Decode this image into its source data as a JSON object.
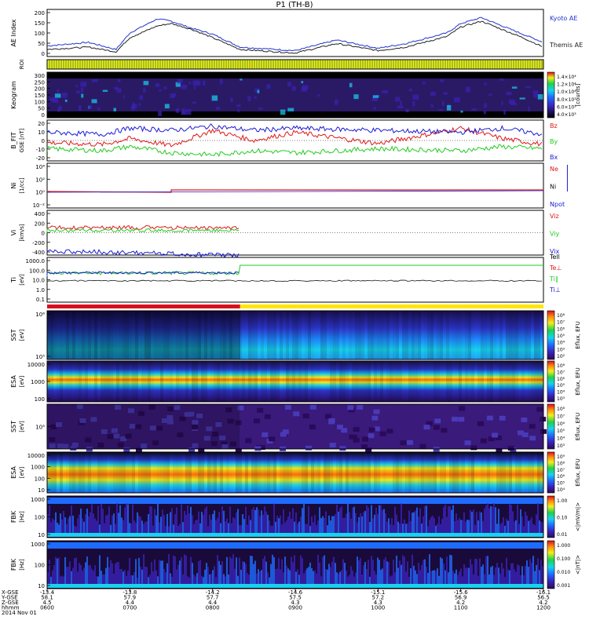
{
  "title": "P1  (TH-B)",
  "colors": {
    "kyoto": "#2233cc",
    "themis": "#222222",
    "bx": "#1b1bd6",
    "by": "#22cc22",
    "bz": "#e01818",
    "ni": "#111111",
    "ne": "#e01818",
    "npot": "#1b1bd6",
    "spec_bg": "#2a0a5a",
    "mode_slow": "#d8101c",
    "mode_fast": "#ffe600"
  },
  "chart_data": [
    {
      "type": "line",
      "panel": "ae",
      "ylabel": "AE Index",
      "yticks": [
        "200",
        "150",
        "100",
        "50",
        "0"
      ],
      "ylim": [
        0,
        200
      ],
      "legend": [
        "Kyoto AE",
        "Themis AE"
      ],
      "series": [
        {
          "name": "Kyoto AE",
          "x": [
            600,
            630,
            650,
            700,
            720,
            730,
            745,
            800,
            820,
            900,
            930,
            1000,
            1020,
            1050,
            1100,
            1115,
            1130,
            1145,
            1200
          ],
          "y": [
            45,
            60,
            30,
            100,
            160,
            150,
            120,
            95,
            40,
            25,
            70,
            35,
            55,
            100,
            140,
            165,
            130,
            95,
            60
          ]
        },
        {
          "name": "Themis AE",
          "x": [
            600,
            630,
            650,
            700,
            720,
            730,
            745,
            800,
            820,
            900,
            930,
            1000,
            1020,
            1050,
            1100,
            1115,
            1130,
            1145,
            1200
          ],
          "y": [
            30,
            40,
            20,
            80,
            130,
            140,
            115,
            80,
            30,
            15,
            55,
            25,
            40,
            85,
            125,
            150,
            115,
            80,
            40
          ]
        }
      ]
    },
    {
      "type": "other",
      "panel": "roi",
      "ylabel": "ROI"
    },
    {
      "type": "heatmap",
      "panel": "keogram",
      "ylabel": "Keogram",
      "yticks": [
        "300",
        "250",
        "200",
        "150",
        "100",
        "50",
        "0"
      ],
      "colorbar": {
        "label": "[counts]",
        "ticks": [
          "1.4×10⁴",
          "1.2×10⁴",
          "1.0×10⁴",
          "8.0×10³",
          "6.0×10³",
          "4.0×10³"
        ]
      }
    },
    {
      "type": "line",
      "panel": "b",
      "ylabel": "B_FIT",
      "yunit": "GSE [nT]",
      "yticks": [
        "20",
        "10",
        "0",
        "-10",
        "-20"
      ],
      "ylim": [
        -20,
        20
      ],
      "legend": [
        "Bz",
        "By",
        "Bx"
      ],
      "series": [
        {
          "name": "Bz",
          "x": [
            600,
            640,
            700,
            730,
            800,
            830,
            900,
            1000,
            1100,
            1130,
            1200
          ],
          "y": [
            -2,
            -4,
            2,
            -5,
            10,
            0,
            8,
            -3,
            12,
            2,
            -4
          ]
        },
        {
          "name": "By",
          "x": [
            600,
            640,
            700,
            730,
            800,
            830,
            900,
            1000,
            1100,
            1130,
            1200
          ],
          "y": [
            -8,
            -10,
            -6,
            -12,
            -14,
            -10,
            -12,
            -8,
            -10,
            -6,
            -8
          ]
        },
        {
          "name": "Bx",
          "x": [
            600,
            640,
            700,
            730,
            800,
            830,
            900,
            1000,
            1100,
            1130,
            1200
          ],
          "y": [
            8,
            6,
            12,
            10,
            14,
            10,
            12,
            10,
            8,
            12,
            6
          ]
        }
      ]
    },
    {
      "type": "line",
      "panel": "n",
      "ylabel": "Ni",
      "yunit": "[1/cc]",
      "yticks": [
        "10⁴",
        "10²",
        "10⁰",
        "10⁻²"
      ],
      "legend": [
        "Ne",
        "Ni",
        "Npot"
      ]
    },
    {
      "type": "line",
      "panel": "v",
      "ylabel": "Vi",
      "yunit": "[km/s]",
      "yticks": [
        "400",
        "200",
        "0",
        "-200",
        "-400"
      ],
      "ylim": [
        -400,
        400
      ],
      "legend": [
        "Viz",
        "Viy",
        "Vix"
      ]
    },
    {
      "type": "line",
      "panel": "t",
      "ylabel": "Ti",
      "yunit": "[eV]",
      "yticks": [
        "1000.0",
        "100.0",
        "10.0",
        "1.0",
        "0.1"
      ],
      "legend": [
        "Tell",
        "Te⊥",
        "Ti∥",
        "Ti⊥"
      ]
    },
    {
      "type": "heatmap",
      "panel": "sst_i",
      "ylabel": "SST",
      "yunit": "[eV]",
      "yticks": [
        "10⁶",
        "10⁵"
      ],
      "colorbar": {
        "label": "Eflux, EFU",
        "ticks": [
          "10⁸",
          "10⁷",
          "10⁶",
          "10⁵",
          "10⁴",
          "10³",
          "10²"
        ]
      }
    },
    {
      "type": "heatmap",
      "panel": "esa_i",
      "ylabel": "ESA",
      "yunit": "[eV]",
      "yticks": [
        "10000",
        "1000",
        "100"
      ],
      "colorbar": {
        "label": "Eflux, EFU",
        "ticks": [
          "10⁸",
          "10⁷",
          "10⁶",
          "10⁵",
          "10⁴",
          "10³"
        ]
      }
    },
    {
      "type": "heatmap",
      "panel": "sst_e",
      "ylabel": "SST",
      "yunit": "[eV]",
      "yticks": [
        "10⁵"
      ],
      "colorbar": {
        "label": "Eflux, EFU",
        "ticks": [
          "10⁸",
          "10⁷",
          "10⁶",
          "10⁵",
          "10⁴",
          "10³"
        ]
      }
    },
    {
      "type": "heatmap",
      "panel": "esa_e",
      "ylabel": "ESA",
      "yunit": "[eV]",
      "yticks": [
        "10000",
        "1000",
        "100",
        "10"
      ],
      "colorbar": {
        "label": "Eflux, EFU",
        "ticks": [
          "10⁹",
          "10⁸",
          "10⁷",
          "10⁶",
          "10⁵",
          "10⁴"
        ]
      }
    },
    {
      "type": "heatmap",
      "panel": "fbk_e",
      "ylabel": "FBK",
      "yunit": "[Hz]",
      "yticks": [
        "1000",
        "100",
        "10"
      ],
      "colorbar": {
        "label": "<|mV/m|>",
        "ticks": [
          "1.00",
          "0.10",
          "0.01"
        ]
      }
    },
    {
      "type": "heatmap",
      "panel": "fbk_b",
      "ylabel": "FBK",
      "yunit": "[Hz]",
      "yticks": [
        "1000",
        "100",
        "10"
      ],
      "colorbar": {
        "label": "<|nT|>",
        "ticks": [
          "1.000",
          "0.100",
          "0.010",
          "0.001"
        ]
      }
    }
  ],
  "xaxis": {
    "row_labels": [
      "X-GSE",
      "Y-GSE",
      "Z-GSE",
      "hhmm",
      "2014 Nov 01"
    ],
    "ticks": [
      {
        "x": "-13.4",
        "y": "58.1",
        "z": "4.5",
        "t": "0600"
      },
      {
        "x": "-13.8",
        "y": "57.9",
        "z": "4.4",
        "t": "0700"
      },
      {
        "x": "-14.2",
        "y": "57.7",
        "z": "4.4",
        "t": "0800"
      },
      {
        "x": "-14.6",
        "y": "57.5",
        "z": "4.3",
        "t": "0900"
      },
      {
        "x": "-15.1",
        "y": "57.2",
        "z": "4.3",
        "t": "1000"
      },
      {
        "x": "-15.6",
        "y": "56.9",
        "z": "4.2",
        "t": "1100"
      },
      {
        "x": "-16.1",
        "y": "56.5",
        "z": "4.2",
        "t": "1200"
      }
    ]
  }
}
